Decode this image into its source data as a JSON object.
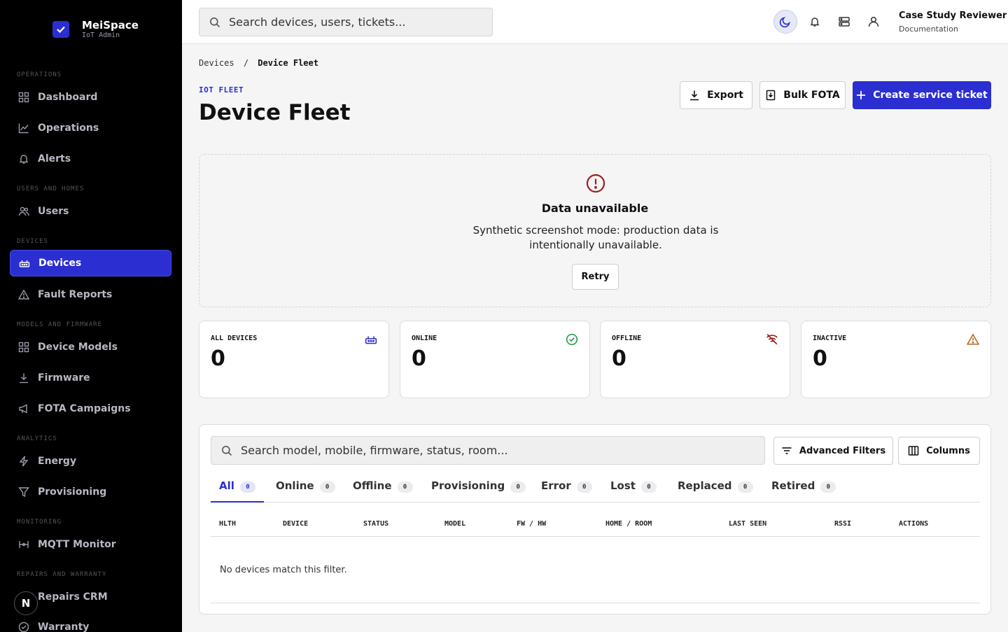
{
  "brand": {
    "name": "MeiSpace",
    "subtitle": "IoT Admin"
  },
  "sidebar": {
    "sections": {
      "operations": "OPERATIONS",
      "users_homes": "USERS AND HOMES",
      "devices": "DEVICES",
      "models_firmware": "MODELS AND FIRMWARE",
      "analytics": "ANALYTICS",
      "monitoring": "MONITORING",
      "repairs": "REPAIRS AND WARRANTY"
    },
    "items": {
      "dashboard": "Dashboard",
      "operations": "Operations",
      "alerts": "Alerts",
      "users": "Users",
      "devices": "Devices",
      "fault_reports": "Fault Reports",
      "device_models": "Device Models",
      "firmware": "Firmware",
      "fota_campaigns": "FOTA Campaigns",
      "energy": "Energy",
      "provisioning": "Provisioning",
      "mqtt_monitor": "MQTT Monitor",
      "repairs_crm": "Repairs CRM",
      "warranty": "Warranty"
    },
    "badge": "N"
  },
  "topbar": {
    "search_placeholder": "Search devices, users, tickets...",
    "user_name": "Case Study Reviewer",
    "user_role": "Documentation"
  },
  "breadcrumb": {
    "parent": "Devices",
    "separator": "/",
    "current": "Device Fleet"
  },
  "header": {
    "eyebrow": "IOT FLEET",
    "title": "Device Fleet",
    "export_label": "Export",
    "bulk_label": "Bulk FOTA",
    "create_label": "Create service ticket"
  },
  "alert": {
    "title": "Data unavailable",
    "message": "Synthetic screenshot mode: production data is intentionally unavailable.",
    "retry_label": "Retry"
  },
  "stats": {
    "all": {
      "label": "ALL DEVICES",
      "value": "0"
    },
    "online": {
      "label": "ONLINE",
      "value": "0"
    },
    "offline": {
      "label": "OFFLINE",
      "value": "0"
    },
    "inactive": {
      "label": "INACTIVE",
      "value": "0"
    }
  },
  "table": {
    "search_placeholder": "Search model, mobile, firmware, status, room...",
    "filters_label": "Advanced Filters",
    "columns_label": "Columns",
    "tabs": {
      "all": {
        "label": "All",
        "count": "0"
      },
      "online": {
        "label": "Online",
        "count": "0"
      },
      "offline": {
        "label": "Offline",
        "count": "0"
      },
      "provisioning": {
        "label": "Provisioning",
        "count": "0"
      },
      "error": {
        "label": "Error",
        "count": "0"
      },
      "lost": {
        "label": "Lost",
        "count": "0"
      },
      "replaced": {
        "label": "Replaced",
        "count": "0"
      },
      "retired": {
        "label": "Retired",
        "count": "0"
      }
    },
    "headers": {
      "health": "HLTH",
      "device": "DEVICE",
      "status": "STATUS",
      "model": "MODEL",
      "fw_hw": "FW / HW",
      "home_room": "HOME / ROOM",
      "last_seen": "LAST SEEN",
      "rssi": "RSSI",
      "actions": "ACTIONS"
    },
    "empty_message": "No devices match this filter."
  },
  "colors": {
    "accent": "#2b2fd1",
    "success": "#2e9e4f",
    "danger": "#a11d1d",
    "warning": "#b5651d"
  }
}
